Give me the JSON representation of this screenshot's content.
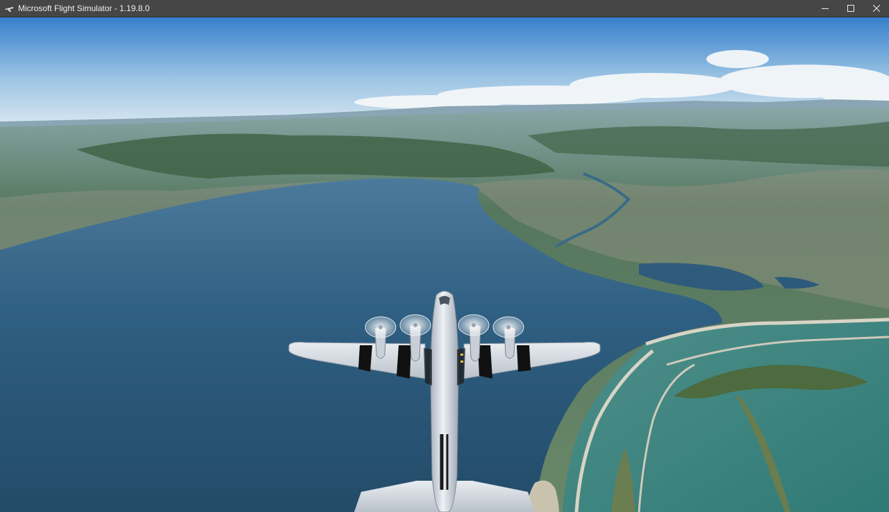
{
  "window": {
    "title": "Microsoft Flight Simulator - 1.19.8.0",
    "icon": "plane-icon"
  },
  "controls": {
    "minimize_icon": "minimize-icon",
    "maximize_icon": "maximize-icon",
    "close_icon": "close-icon"
  },
  "scene": {
    "sky_top": "#2f78c6",
    "sky_horizon": "#d4e6f2",
    "lake_color": "#2a5578",
    "land_color": "#5f7f63",
    "aircraft_color": "#dfe4ea",
    "invasion_stripe_color": "#121212"
  }
}
